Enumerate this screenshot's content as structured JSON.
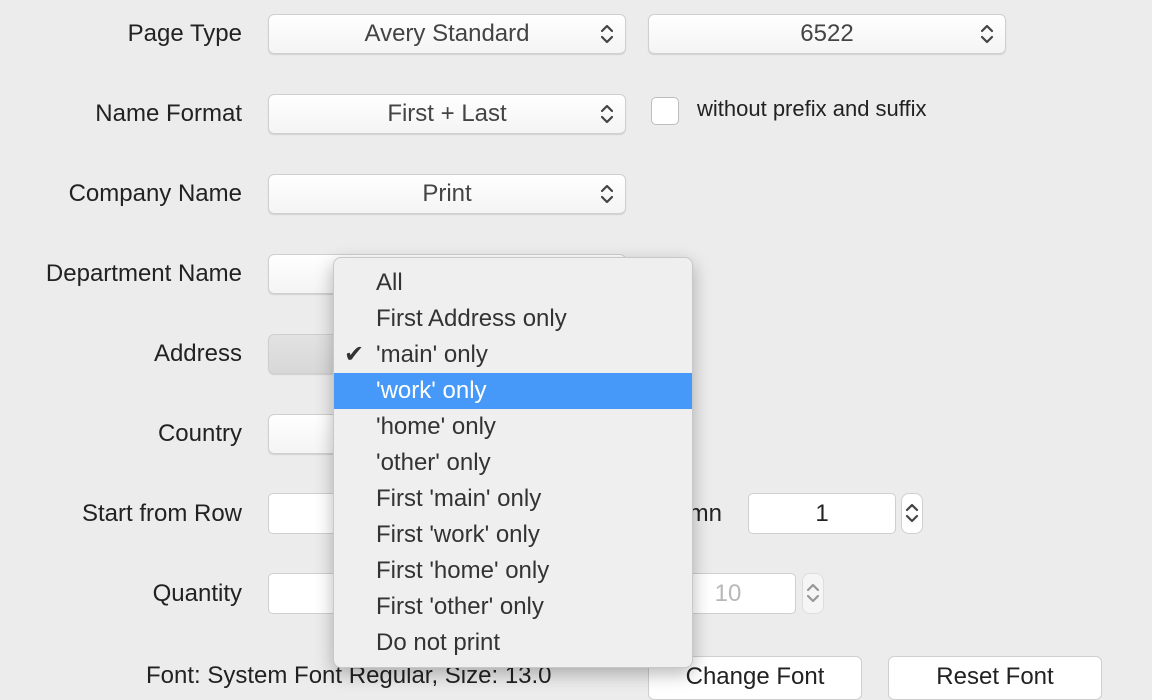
{
  "page_type": {
    "label": "Page Type",
    "value": "Avery Standard",
    "product": "6522"
  },
  "name_format": {
    "label": "Name Format",
    "value": "First + Last",
    "checkbox_label": "without prefix and suffix",
    "checked": false
  },
  "company_name": {
    "label": "Company Name",
    "value": "Print"
  },
  "department_name": {
    "label": "Department Name"
  },
  "address": {
    "label": "Address"
  },
  "country": {
    "label": "Country"
  },
  "start_row": {
    "label": "Start from Row",
    "column_label": "mn",
    "column_value": "1"
  },
  "quantity": {
    "label": "Quantity",
    "value": "10"
  },
  "font": {
    "text": "Font: System Font Regular, Size: 13.0",
    "change_label": "Change Font",
    "reset_label": "Reset Font"
  },
  "menu": {
    "items": [
      {
        "label": "All"
      },
      {
        "label": "First Address only"
      },
      {
        "label": "'main' only",
        "checked": true
      },
      {
        "label": "'work' only",
        "highlighted": true
      },
      {
        "label": "'home' only"
      },
      {
        "label": "'other' only"
      },
      {
        "label": "First 'main' only"
      },
      {
        "label": "First 'work' only"
      },
      {
        "label": "First 'home' only"
      },
      {
        "label": "First 'other' only"
      },
      {
        "label": "Do not print"
      }
    ],
    "highlight_color": "#4799f9"
  }
}
